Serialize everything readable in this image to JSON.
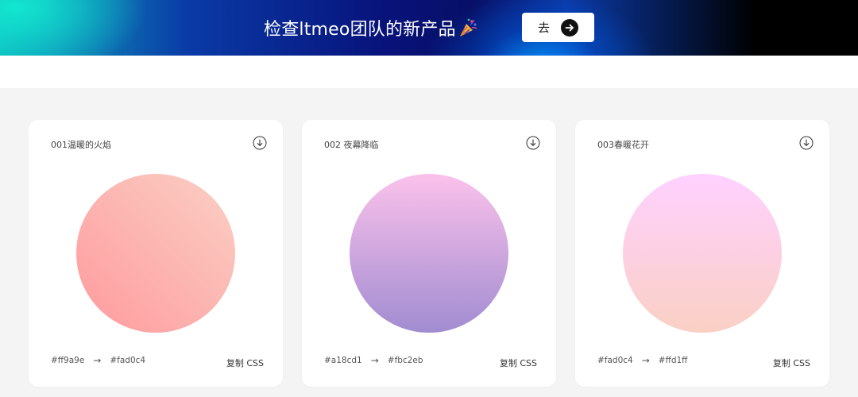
{
  "banner": {
    "title": "检查ltmeo团队的新产品",
    "go_label": "去",
    "colors": {
      "left": "#0fb3bf",
      "mid": "#08127a",
      "right": "#000000"
    }
  },
  "cards": [
    {
      "title": "001温暖的火焰",
      "from_color": "#ff9a9e",
      "to_color": "#fad0c4",
      "arrow": "→",
      "copy_label": "复制 CSS",
      "gradient": {
        "start": "#ff9a9e",
        "end": "#fad0c4",
        "direction": "bottom-left to top-right"
      }
    },
    {
      "title": "002 夜幕降临",
      "from_color": "#a18cd1",
      "to_color": "#fbc2eb",
      "arrow": "→",
      "copy_label": "复制 CSS",
      "gradient": {
        "start": "#a18cd1",
        "end": "#fbc2eb",
        "direction": "bottom to top"
      }
    },
    {
      "title": "003春暖花开",
      "from_color": "#fad0c4",
      "to_color": "#ffd1ff",
      "arrow": "→",
      "copy_label": "复制 CSS",
      "gradient": {
        "start": "#fad0c4",
        "end": "#ffd1ff",
        "direction": "bottom to top"
      }
    }
  ],
  "icons": {
    "party": "party-popper-icon",
    "arrow_right": "arrow-right-circle-icon",
    "download": "download-circle-icon"
  }
}
